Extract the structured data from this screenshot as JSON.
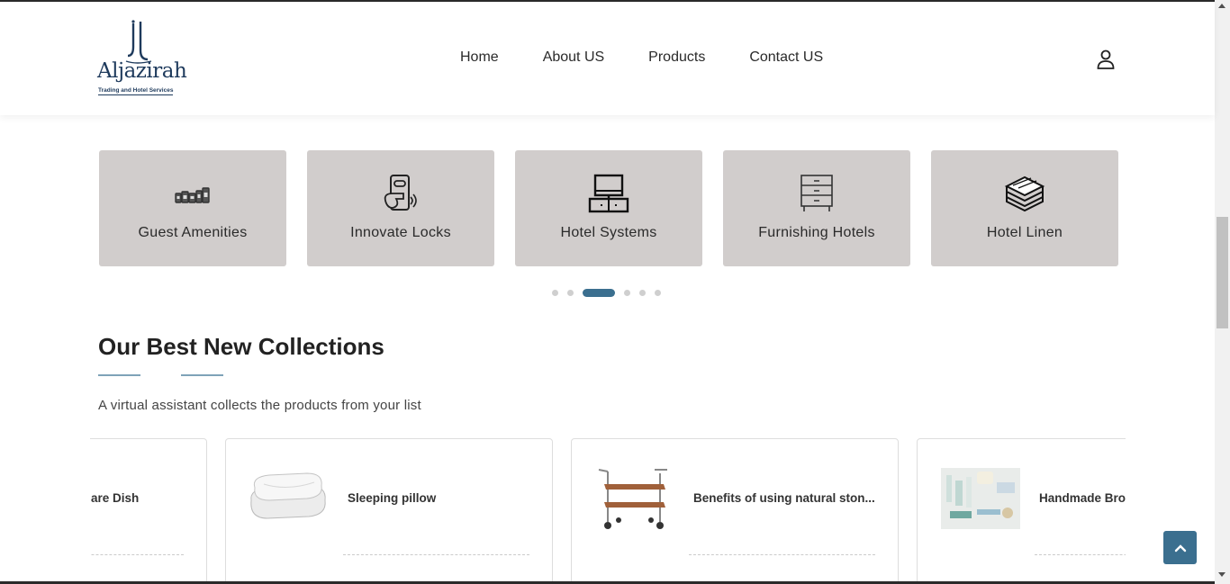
{
  "brand": {
    "name": "Aljazirah",
    "tagline": "Trading and Hotel Services"
  },
  "nav": {
    "items": [
      "Home",
      "About US",
      "Products",
      "Contact US"
    ]
  },
  "categories": [
    {
      "label": "Guest Amenities",
      "icon": "amenities-bottles-icon"
    },
    {
      "label": "Innovate Locks",
      "icon": "keycard-lock-icon"
    },
    {
      "label": "Hotel Systems",
      "icon": "computer-desk-icon"
    },
    {
      "label": "Furnishing Hotels",
      "icon": "dresser-icon"
    },
    {
      "label": "Hotel Linen",
      "icon": "folded-linen-icon"
    }
  ],
  "carousel": {
    "dot_count": 6,
    "active_index": 2
  },
  "collections": {
    "title": "Our Best New Collections",
    "subtitle": "A virtual assistant collects the products from your list",
    "products": [
      {
        "name": "are Dish"
      },
      {
        "name": "Sleeping pillow"
      },
      {
        "name": "Benefits of using natural ston..."
      },
      {
        "name": "Handmade Bro"
      }
    ]
  },
  "colors": {
    "accent": "#3b6f8f",
    "card_bg": "#d1cdcc",
    "brand_navy": "#1e3a5c"
  }
}
